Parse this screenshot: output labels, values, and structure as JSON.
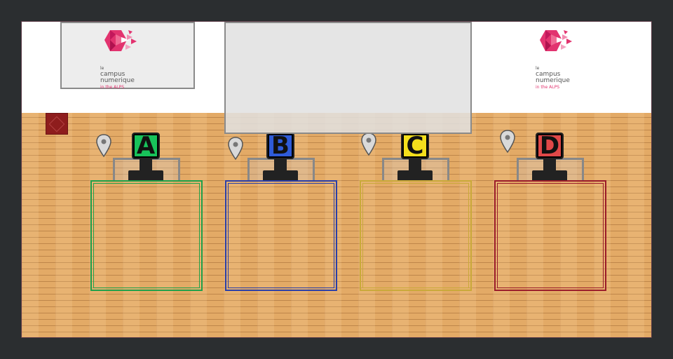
{
  "brand": {
    "logo_line1": "le",
    "logo_line2": "campus",
    "logo_line3": "numerique",
    "logo_line4": "in the ALPS"
  },
  "colors": {
    "wall": "#ffffff",
    "floor": "#e3aa66",
    "brand_pink": "#e2336f"
  },
  "stations": [
    {
      "letter": "A",
      "color": "#18c25a",
      "border": "#20a04a"
    },
    {
      "letter": "B",
      "color": "#2f5bd8",
      "border": "#2a3fa8"
    },
    {
      "letter": "C",
      "color": "#f4df1c",
      "border": "#c9a93a"
    },
    {
      "letter": "D",
      "color": "#e04848",
      "border": "#9a1c2a"
    }
  ],
  "icons": {
    "pin": "map-pin-icon",
    "rug": "rug-tile"
  }
}
